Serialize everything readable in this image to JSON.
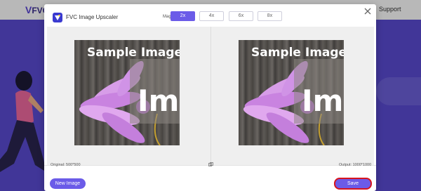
{
  "background": {
    "logo_text": "FVC",
    "nav_support": "Support"
  },
  "dialog": {
    "title": "FVC Image Upscaler",
    "magnification_label": "Magnification:",
    "magnification_options": [
      "2x",
      "4x",
      "6x",
      "8x"
    ],
    "selected_magnification": "2x",
    "original_label": "Original: 500*500",
    "output_label": "Output: 1000*1000",
    "preview_image": {
      "text_top": "Sample Image",
      "text_big": "Ima"
    },
    "new_image_label": "New Image",
    "save_label": "Save"
  },
  "colors": {
    "accent": "#6b5be8",
    "hero": "#5b4cd3",
    "save_highlight_border": "#d7141e"
  }
}
